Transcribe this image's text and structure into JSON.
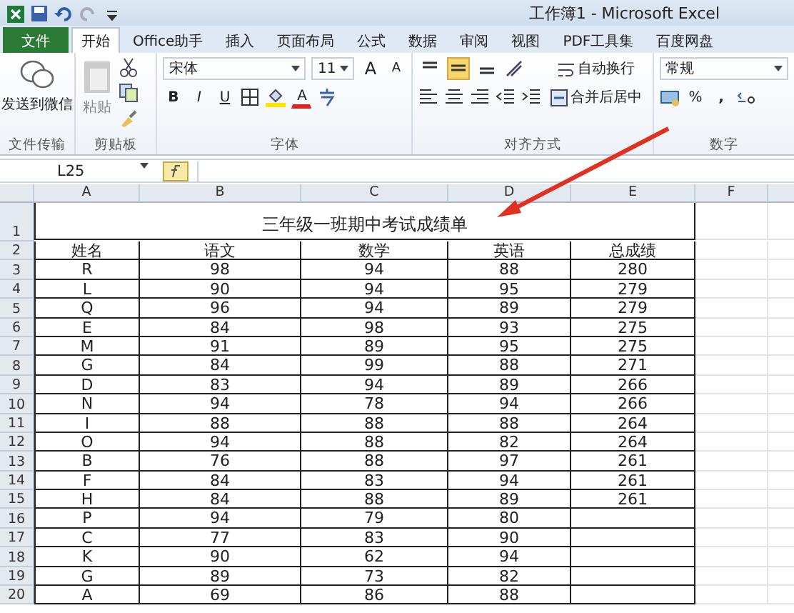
{
  "window": {
    "title": "工作簿1 - Microsoft Excel"
  },
  "tabs": [
    {
      "label": "文件",
      "kind": "file",
      "selected": false
    },
    {
      "label": "开始",
      "kind": "tab",
      "selected": true
    },
    {
      "label": "Office助手",
      "kind": "tab",
      "selected": false
    },
    {
      "label": "插入",
      "kind": "tab",
      "selected": false
    },
    {
      "label": "页面布局",
      "kind": "tab",
      "selected": false
    },
    {
      "label": "公式",
      "kind": "tab",
      "selected": false
    },
    {
      "label": "数据",
      "kind": "tab",
      "selected": false
    },
    {
      "label": "审阅",
      "kind": "tab",
      "selected": false
    },
    {
      "label": "视图",
      "kind": "tab",
      "selected": false
    },
    {
      "label": "PDF工具集",
      "kind": "tab",
      "selected": false
    },
    {
      "label": "百度网盘",
      "kind": "tab",
      "selected": false
    }
  ],
  "ribbon": {
    "share": {
      "button": "发送到微信",
      "group": "文件传输"
    },
    "clipboard": {
      "button": "粘贴",
      "group": "剪贴板"
    },
    "font": {
      "name": "宋体",
      "size": "11",
      "grow": "A",
      "shrink": "A",
      "bold": "B",
      "italic": "I",
      "underline": "U",
      "color_label": "A",
      "group": "字体"
    },
    "alignment": {
      "vertical": [
        {
          "selected": false
        },
        {
          "selected": true
        },
        {
          "selected": false
        }
      ],
      "wrap": "自动换行",
      "merge": "合并后居中",
      "group": "对齐方式"
    },
    "number": {
      "format": "常规",
      "percent": "%",
      "comma": ",",
      "group": "数字"
    }
  },
  "formula_bar": {
    "name_box": "L25"
  },
  "sheet": {
    "columns": [
      "A",
      "B",
      "C",
      "D",
      "E",
      "F"
    ],
    "title": "三年级一班期中考试成绩单",
    "row_numbers": [
      "1",
      "2",
      "3",
      "4",
      "5",
      "6",
      "7",
      "8",
      "9",
      "10",
      "11",
      "12",
      "13",
      "14",
      "15",
      "16",
      "17",
      "18",
      "19",
      "20"
    ],
    "header": [
      "姓名",
      "语文",
      "数学",
      "英语",
      "总成绩"
    ],
    "rows": [
      [
        "R",
        "98",
        "94",
        "88",
        "280"
      ],
      [
        "L",
        "90",
        "94",
        "95",
        "279"
      ],
      [
        "Q",
        "96",
        "94",
        "89",
        "279"
      ],
      [
        "E",
        "84",
        "98",
        "93",
        "275"
      ],
      [
        "M",
        "91",
        "89",
        "95",
        "275"
      ],
      [
        "G",
        "84",
        "99",
        "88",
        "271"
      ],
      [
        "D",
        "83",
        "94",
        "89",
        "266"
      ],
      [
        "N",
        "94",
        "78",
        "94",
        "266"
      ],
      [
        "I",
        "88",
        "88",
        "88",
        "264"
      ],
      [
        "O",
        "94",
        "88",
        "82",
        "264"
      ],
      [
        "B",
        "76",
        "88",
        "97",
        "261"
      ],
      [
        "F",
        "84",
        "83",
        "94",
        "261"
      ],
      [
        "H",
        "84",
        "88",
        "89",
        "261"
      ],
      [
        "P",
        "94",
        "79",
        "80"
      ],
      [
        "C",
        "77",
        "83",
        "90"
      ],
      [
        "K",
        "90",
        "62",
        "94"
      ],
      [
        "G",
        "89",
        "73",
        "82"
      ],
      [
        "A",
        "69",
        "86",
        "88"
      ]
    ]
  }
}
